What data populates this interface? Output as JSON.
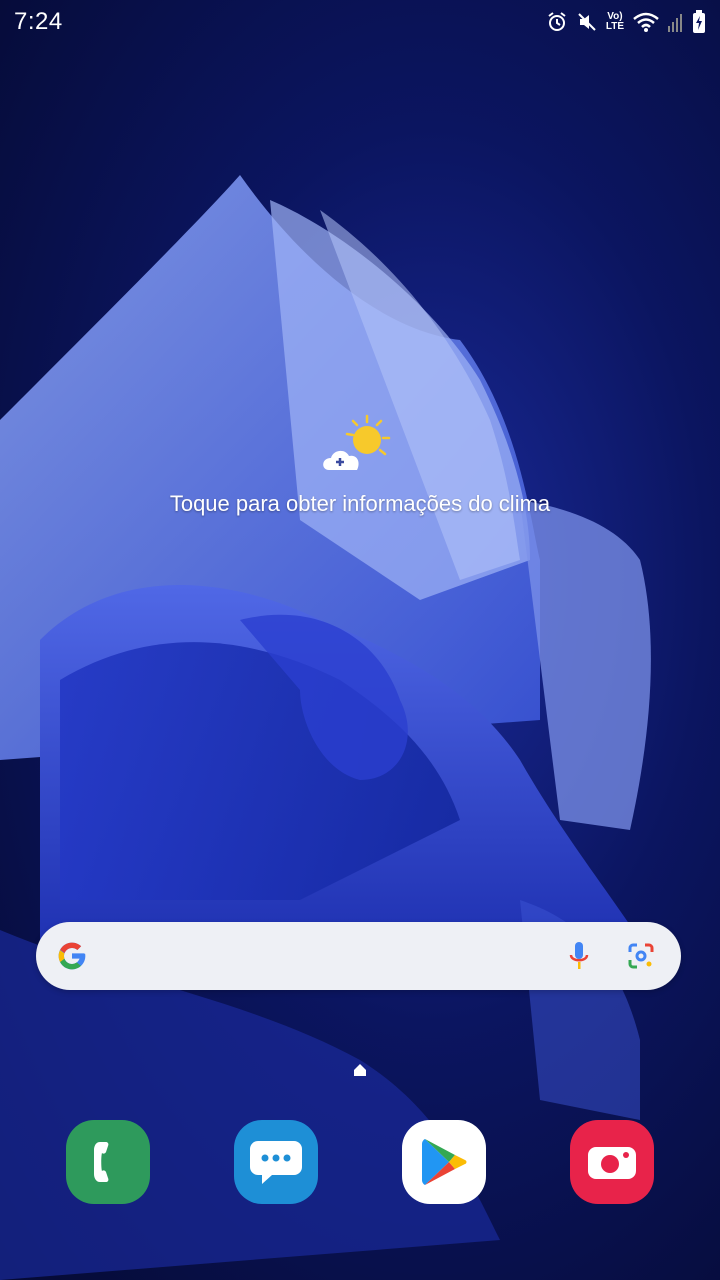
{
  "status_bar": {
    "time": "7:24",
    "volte_top": "Vo)",
    "volte_bottom": "LTE"
  },
  "weather_widget": {
    "message": "Toque para obter informações do clima"
  },
  "search_widget": {
    "icons": [
      "google-logo-icon",
      "microphone-icon",
      "google-lens-icon"
    ]
  },
  "dock": {
    "apps": [
      {
        "name": "phone",
        "icon": "phone-icon",
        "color": "#2e9a5c"
      },
      {
        "name": "messages",
        "icon": "messages-icon",
        "color": "#1e8fd6"
      },
      {
        "name": "play-store",
        "icon": "play-store-icon",
        "color": "#ffffff"
      },
      {
        "name": "camera",
        "icon": "camera-icon",
        "color": "#e8234a"
      }
    ]
  },
  "colors": {
    "wallpaper_dark": "#050a33",
    "wallpaper_mid": "#1a2a9a",
    "search_bg": "#eef0f5"
  }
}
